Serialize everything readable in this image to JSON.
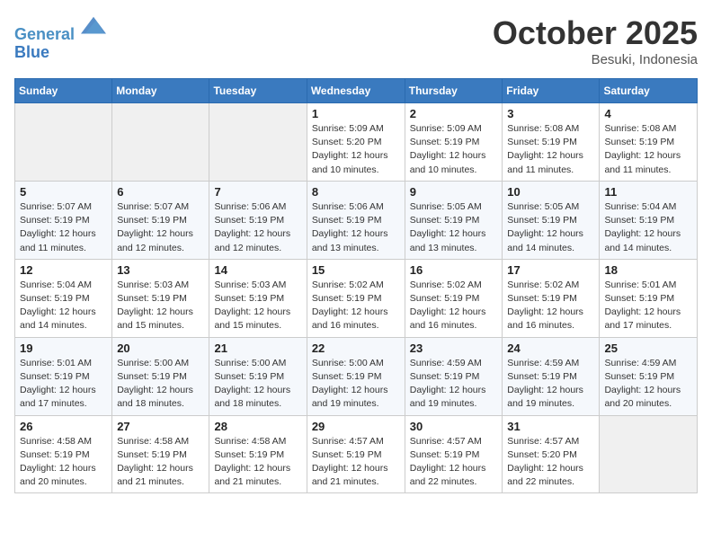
{
  "header": {
    "logo_line1": "General",
    "logo_line2": "Blue",
    "month": "October 2025",
    "location": "Besuki, Indonesia"
  },
  "weekdays": [
    "Sunday",
    "Monday",
    "Tuesday",
    "Wednesday",
    "Thursday",
    "Friday",
    "Saturday"
  ],
  "weeks": [
    [
      {
        "day": "",
        "info": ""
      },
      {
        "day": "",
        "info": ""
      },
      {
        "day": "",
        "info": ""
      },
      {
        "day": "1",
        "info": "Sunrise: 5:09 AM\nSunset: 5:20 PM\nDaylight: 12 hours\nand 10 minutes."
      },
      {
        "day": "2",
        "info": "Sunrise: 5:09 AM\nSunset: 5:19 PM\nDaylight: 12 hours\nand 10 minutes."
      },
      {
        "day": "3",
        "info": "Sunrise: 5:08 AM\nSunset: 5:19 PM\nDaylight: 12 hours\nand 11 minutes."
      },
      {
        "day": "4",
        "info": "Sunrise: 5:08 AM\nSunset: 5:19 PM\nDaylight: 12 hours\nand 11 minutes."
      }
    ],
    [
      {
        "day": "5",
        "info": "Sunrise: 5:07 AM\nSunset: 5:19 PM\nDaylight: 12 hours\nand 11 minutes."
      },
      {
        "day": "6",
        "info": "Sunrise: 5:07 AM\nSunset: 5:19 PM\nDaylight: 12 hours\nand 12 minutes."
      },
      {
        "day": "7",
        "info": "Sunrise: 5:06 AM\nSunset: 5:19 PM\nDaylight: 12 hours\nand 12 minutes."
      },
      {
        "day": "8",
        "info": "Sunrise: 5:06 AM\nSunset: 5:19 PM\nDaylight: 12 hours\nand 13 minutes."
      },
      {
        "day": "9",
        "info": "Sunrise: 5:05 AM\nSunset: 5:19 PM\nDaylight: 12 hours\nand 13 minutes."
      },
      {
        "day": "10",
        "info": "Sunrise: 5:05 AM\nSunset: 5:19 PM\nDaylight: 12 hours\nand 14 minutes."
      },
      {
        "day": "11",
        "info": "Sunrise: 5:04 AM\nSunset: 5:19 PM\nDaylight: 12 hours\nand 14 minutes."
      }
    ],
    [
      {
        "day": "12",
        "info": "Sunrise: 5:04 AM\nSunset: 5:19 PM\nDaylight: 12 hours\nand 14 minutes."
      },
      {
        "day": "13",
        "info": "Sunrise: 5:03 AM\nSunset: 5:19 PM\nDaylight: 12 hours\nand 15 minutes."
      },
      {
        "day": "14",
        "info": "Sunrise: 5:03 AM\nSunset: 5:19 PM\nDaylight: 12 hours\nand 15 minutes."
      },
      {
        "day": "15",
        "info": "Sunrise: 5:02 AM\nSunset: 5:19 PM\nDaylight: 12 hours\nand 16 minutes."
      },
      {
        "day": "16",
        "info": "Sunrise: 5:02 AM\nSunset: 5:19 PM\nDaylight: 12 hours\nand 16 minutes."
      },
      {
        "day": "17",
        "info": "Sunrise: 5:02 AM\nSunset: 5:19 PM\nDaylight: 12 hours\nand 16 minutes."
      },
      {
        "day": "18",
        "info": "Sunrise: 5:01 AM\nSunset: 5:19 PM\nDaylight: 12 hours\nand 17 minutes."
      }
    ],
    [
      {
        "day": "19",
        "info": "Sunrise: 5:01 AM\nSunset: 5:19 PM\nDaylight: 12 hours\nand 17 minutes."
      },
      {
        "day": "20",
        "info": "Sunrise: 5:00 AM\nSunset: 5:19 PM\nDaylight: 12 hours\nand 18 minutes."
      },
      {
        "day": "21",
        "info": "Sunrise: 5:00 AM\nSunset: 5:19 PM\nDaylight: 12 hours\nand 18 minutes."
      },
      {
        "day": "22",
        "info": "Sunrise: 5:00 AM\nSunset: 5:19 PM\nDaylight: 12 hours\nand 19 minutes."
      },
      {
        "day": "23",
        "info": "Sunrise: 4:59 AM\nSunset: 5:19 PM\nDaylight: 12 hours\nand 19 minutes."
      },
      {
        "day": "24",
        "info": "Sunrise: 4:59 AM\nSunset: 5:19 PM\nDaylight: 12 hours\nand 19 minutes."
      },
      {
        "day": "25",
        "info": "Sunrise: 4:59 AM\nSunset: 5:19 PM\nDaylight: 12 hours\nand 20 minutes."
      }
    ],
    [
      {
        "day": "26",
        "info": "Sunrise: 4:58 AM\nSunset: 5:19 PM\nDaylight: 12 hours\nand 20 minutes."
      },
      {
        "day": "27",
        "info": "Sunrise: 4:58 AM\nSunset: 5:19 PM\nDaylight: 12 hours\nand 21 minutes."
      },
      {
        "day": "28",
        "info": "Sunrise: 4:58 AM\nSunset: 5:19 PM\nDaylight: 12 hours\nand 21 minutes."
      },
      {
        "day": "29",
        "info": "Sunrise: 4:57 AM\nSunset: 5:19 PM\nDaylight: 12 hours\nand 21 minutes."
      },
      {
        "day": "30",
        "info": "Sunrise: 4:57 AM\nSunset: 5:19 PM\nDaylight: 12 hours\nand 22 minutes."
      },
      {
        "day": "31",
        "info": "Sunrise: 4:57 AM\nSunset: 5:20 PM\nDaylight: 12 hours\nand 22 minutes."
      },
      {
        "day": "",
        "info": ""
      }
    ]
  ]
}
